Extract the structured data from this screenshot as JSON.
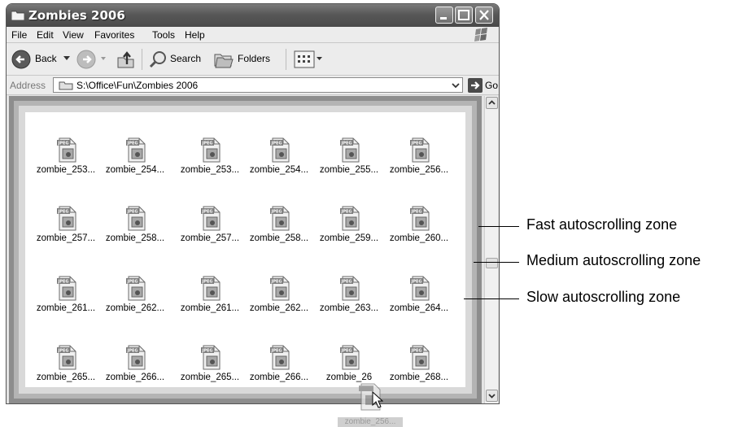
{
  "window": {
    "title": "Zombies 2006",
    "menu": [
      "File",
      "Edit",
      "View",
      "Favorites",
      "Tools",
      "Help"
    ],
    "toolbar": {
      "back_label": "Back",
      "search_label": "Search",
      "folders_label": "Folders"
    },
    "address": {
      "label": "Address",
      "path": "S:\\Office\\Fun\\Zombies 2006",
      "go_label": "Go"
    }
  },
  "files": [
    "zombie_253...",
    "zombie_254...",
    "zombie_253...",
    "zombie_254...",
    "zombie_255...",
    "zombie_256...",
    "zombie_257...",
    "zombie_258...",
    "zombie_257...",
    "zombie_258...",
    "zombie_259...",
    "zombie_260...",
    "zombie_261...",
    "zombie_262...",
    "zombie_261...",
    "zombie_262...",
    "zombie_263...",
    "zombie_264...",
    "zombie_265...",
    "zombie_266...",
    "zombie_265...",
    "zombie_266...",
    "zombie_26",
    "zombie_268..."
  ],
  "file_badge": "JPEG",
  "drag": {
    "label": "zombie_256..."
  },
  "callouts": {
    "fast": "Fast autoscrolling zone",
    "medium": "Medium autoscrolling zone",
    "slow": "Slow autoscrolling zone"
  },
  "colors": {
    "zone_fast": "#8d8d8d",
    "zone_medium": "#b4b4b4",
    "zone_slow": "#d9d9d9"
  }
}
